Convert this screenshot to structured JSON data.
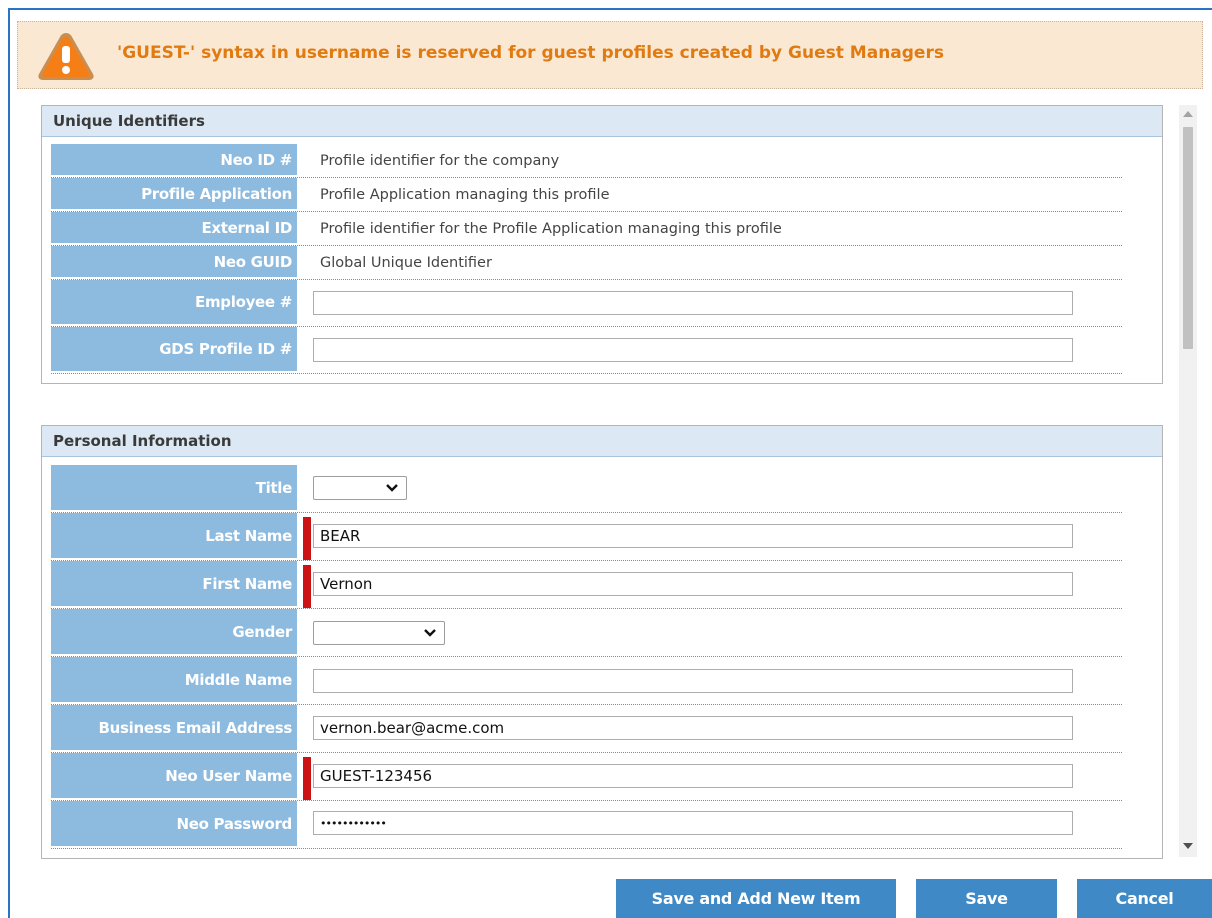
{
  "warning": {
    "icon": "warning-triangle-icon",
    "text": "'GUEST-' syntax in username is reserved for guest profiles created by Guest Managers"
  },
  "unique_identifiers": {
    "title": "Unique Identifiers",
    "rows": [
      {
        "label": "Neo ID #",
        "text": "Profile identifier for the company"
      },
      {
        "label": "Profile Application",
        "text": "Profile Application managing this profile"
      },
      {
        "label": "External ID",
        "text": "Profile identifier for the Profile Application managing this profile"
      },
      {
        "label": "Neo GUID",
        "text": "Global Unique Identifier"
      },
      {
        "label": "Employee #",
        "value": ""
      },
      {
        "label": "GDS Profile ID #",
        "value": ""
      }
    ]
  },
  "personal_information": {
    "title": "Personal Information",
    "rows": [
      {
        "label": "Title",
        "value": ""
      },
      {
        "label": "Last Name",
        "value": "BEAR",
        "required": true
      },
      {
        "label": "First Name",
        "value": "Vernon",
        "required": true
      },
      {
        "label": "Gender",
        "value": ""
      },
      {
        "label": "Middle Name",
        "value": ""
      },
      {
        "label": "Business Email Address",
        "value": "vernon.bear@acme.com"
      },
      {
        "label": "Neo User Name",
        "value": "GUEST-123456",
        "required": true
      },
      {
        "label": "Neo Password",
        "value": "••••••••••••"
      }
    ]
  },
  "buttons": {
    "save_add_new": "Save and Add New Item",
    "save": "Save",
    "cancel": "Cancel"
  },
  "colors": {
    "accent": "#3f89c6",
    "label_bg": "#8dbadf",
    "section_header_bg": "#dce9f4",
    "warning_bg": "#fbe8d2",
    "warning_text": "#e07b12",
    "required_marker": "#cc1417"
  }
}
